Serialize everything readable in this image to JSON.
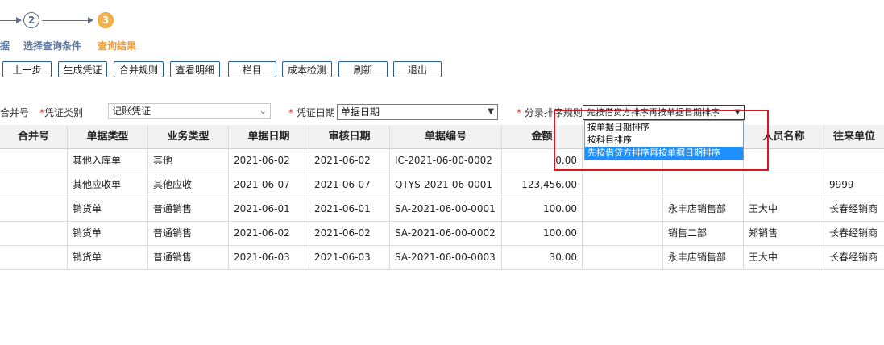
{
  "stepper": {
    "steps": [
      {
        "number": "2",
        "label": "选择查询条件",
        "state": "done"
      },
      {
        "number": "3",
        "label": "查询结果",
        "state": "active"
      }
    ],
    "clipped_label": "据"
  },
  "toolbar": {
    "buttons": [
      "上一步",
      "生成凭证",
      "合并规则",
      "查看明细",
      "栏目",
      "成本检测",
      "刷新",
      "退出"
    ]
  },
  "filters": {
    "merge_label": "合并号",
    "voucher_type_label": "凭证类别",
    "voucher_type_value": "记账凭证",
    "voucher_date_label": "凭证日期",
    "voucher_date_value": "单据日期",
    "entry_sort_label": "分录排序规则",
    "entry_sort_value": "先按借贷方排序再按单据日期排序",
    "entry_sort_options": [
      "按单据日期排序",
      "按科目排序",
      "先按借贷方排序再按单据日期排序"
    ]
  },
  "grid": {
    "columns": [
      "合并号",
      "单据类型",
      "业务类型",
      "单据日期",
      "审核日期",
      "单据编号",
      "金额",
      "",
      "",
      "人员名称",
      "往来单位"
    ],
    "rows": [
      [
        "",
        "其他入库单",
        "其他",
        "2021-06-02",
        "2021-06-02",
        "IC-2021-06-00-0002",
        "0.00",
        "",
        "",
        "",
        ""
      ],
      [
        "",
        "其他应收单",
        "其他应收",
        "2021-06-07",
        "2021-06-07",
        "QTYS-2021-06-0001",
        "123,456.00",
        "",
        "",
        "",
        "9999"
      ],
      [
        "",
        "销货单",
        "普通销售",
        "2021-06-01",
        "2021-06-01",
        "SA-2021-06-00-0001",
        "100.00",
        "",
        "永丰店销售部",
        "王大中",
        "长春经销商"
      ],
      [
        "",
        "销货单",
        "普通销售",
        "2021-06-02",
        "2021-06-02",
        "SA-2021-06-00-0002",
        "100.00",
        "",
        "销售二部",
        "郑销售",
        "长春经销商"
      ],
      [
        "",
        "销货单",
        "普通销售",
        "2021-06-03",
        "2021-06-03",
        "SA-2021-06-00-0003",
        "30.00",
        "",
        "永丰店销售部",
        "王大中",
        "长春经销商"
      ]
    ]
  }
}
